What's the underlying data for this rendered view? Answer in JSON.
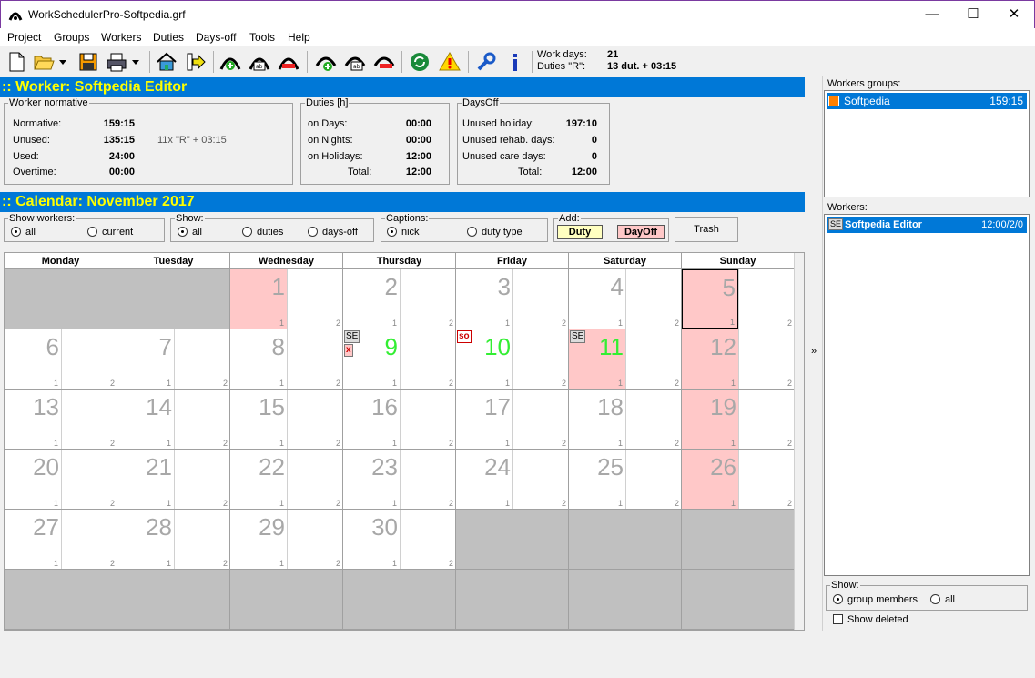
{
  "window": {
    "title": "WorkSchedulerPro-Softpedia.grf",
    "minimize": "—",
    "maximize": "☐",
    "close": "✕"
  },
  "menu": [
    "Project",
    "Groups",
    "Workers",
    "Duties",
    "Days-off",
    "Tools",
    "Help"
  ],
  "toolbar_icons": [
    "new-file-icon",
    "open-folder-icon",
    "dropdown-arrow-icon",
    "save-icon",
    "print-icon",
    "print-dropdown-icon",
    "home-icon",
    "export-arrow-icon",
    "add-worker-icon",
    "edit-worker-icon",
    "remove-worker-icon",
    "add-group-icon",
    "edit-group-icon",
    "remove-group-icon",
    "refresh-icon",
    "warning-icon",
    "tools-wrench-icon",
    "info-icon"
  ],
  "status": {
    "work_days_label": "Work days:",
    "work_days_value": "21",
    "duties_label": "Duties \"R\":",
    "duties_value": "13 dut. + 03:15"
  },
  "worker": {
    "header": ":: Worker: Softpedia Editor",
    "normative": {
      "legend": "Worker normative",
      "normative_label": "Normative:",
      "normative_value": "159:15",
      "unused_label": "Unused:",
      "unused_value": "135:15",
      "unused_note": "11x \"R\" + 03:15",
      "used_label": "Used:",
      "used_value": "24:00",
      "overtime_label": "Overtime:",
      "overtime_value": "00:00"
    },
    "duties": {
      "legend": "Duties [h]",
      "days_label": "on Days:",
      "days_value": "00:00",
      "nights_label": "on Nights:",
      "nights_value": "00:00",
      "holidays_label": "on Holidays:",
      "holidays_value": "12:00",
      "total_label": "Total:",
      "total_value": "12:00"
    },
    "daysoff": {
      "legend": "DaysOff",
      "holiday_label": "Unused holiday:",
      "holiday_value": "197:10",
      "rehab_label": "Unused rehab. days:",
      "rehab_value": "0",
      "care_label": "Unused care days:",
      "care_value": "0",
      "total_label": "Total:",
      "total_value": "12:00"
    }
  },
  "calendar": {
    "header": ":: Calendar: November 2017",
    "show_workers": {
      "legend": "Show workers:",
      "all": "all",
      "current": "current"
    },
    "show": {
      "legend": "Show:",
      "all": "all",
      "duties": "duties",
      "daysoff": "days-off"
    },
    "captions": {
      "legend": "Captions:",
      "nick": "nick",
      "duty_type": "duty type"
    },
    "add": {
      "legend": "Add:",
      "duty": "Duty",
      "dayoff": "DayOff"
    },
    "trash": "Trash",
    "weekdays": [
      "Monday",
      "Tuesday",
      "Wednesday",
      "Thursday",
      "Friday",
      "Saturday",
      "Sunday"
    ],
    "shift_labels": [
      "1",
      "2"
    ],
    "days": [
      {
        "d": "1",
        "col": 2,
        "row": 0,
        "pink": "left"
      },
      {
        "d": "2",
        "col": 3,
        "row": 0
      },
      {
        "d": "3",
        "col": 4,
        "row": 0
      },
      {
        "d": "4",
        "col": 5,
        "row": 0
      },
      {
        "d": "5",
        "col": 6,
        "row": 0,
        "pink": "left",
        "selected": true
      },
      {
        "d": "6",
        "col": 0,
        "row": 1
      },
      {
        "d": "7",
        "col": 1,
        "row": 1
      },
      {
        "d": "8",
        "col": 2,
        "row": 1
      },
      {
        "d": "9",
        "col": 3,
        "row": 1,
        "green": true,
        "tags": [
          "SE",
          "x"
        ]
      },
      {
        "d": "10",
        "col": 4,
        "row": 1,
        "green": true,
        "tags": [
          "so"
        ]
      },
      {
        "d": "11",
        "col": 5,
        "row": 1,
        "green": true,
        "pink": "left",
        "tags": [
          "SE"
        ]
      },
      {
        "d": "12",
        "col": 6,
        "row": 1,
        "pink": "left"
      },
      {
        "d": "13",
        "col": 0,
        "row": 2
      },
      {
        "d": "14",
        "col": 1,
        "row": 2
      },
      {
        "d": "15",
        "col": 2,
        "row": 2
      },
      {
        "d": "16",
        "col": 3,
        "row": 2
      },
      {
        "d": "17",
        "col": 4,
        "row": 2
      },
      {
        "d": "18",
        "col": 5,
        "row": 2
      },
      {
        "d": "19",
        "col": 6,
        "row": 2,
        "pink": "left"
      },
      {
        "d": "20",
        "col": 0,
        "row": 3
      },
      {
        "d": "21",
        "col": 1,
        "row": 3
      },
      {
        "d": "22",
        "col": 2,
        "row": 3
      },
      {
        "d": "23",
        "col": 3,
        "row": 3
      },
      {
        "d": "24",
        "col": 4,
        "row": 3
      },
      {
        "d": "25",
        "col": 5,
        "row": 3
      },
      {
        "d": "26",
        "col": 6,
        "row": 3,
        "pink": "left"
      },
      {
        "d": "27",
        "col": 0,
        "row": 4
      },
      {
        "d": "28",
        "col": 1,
        "row": 4
      },
      {
        "d": "29",
        "col": 2,
        "row": 4
      },
      {
        "d": "30",
        "col": 3,
        "row": 4
      }
    ]
  },
  "right": {
    "collapse": "»",
    "groups_label": "Workers groups:",
    "group": {
      "name": "Softpedia",
      "value": "159:15",
      "color": "#ff8000"
    },
    "workers_label": "Workers:",
    "worker": {
      "badge": "SE",
      "name": "Softpedia Editor",
      "value": "12:00/2/0"
    },
    "show": {
      "legend": "Show:",
      "members": "group members",
      "all": "all"
    },
    "show_deleted": "Show deleted"
  },
  "colors": {
    "header_bg": "#0078d7",
    "header_text": "#ffff00",
    "pink": "#ffc8c8",
    "gray": "#c0c0c0",
    "green": "#33ee33",
    "selection": "#0078d7"
  }
}
